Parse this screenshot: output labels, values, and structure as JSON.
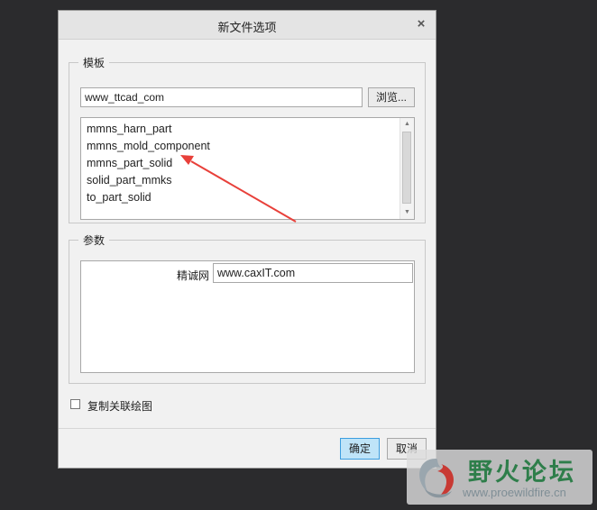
{
  "dialog": {
    "title": "新文件选项",
    "close_glyph": "×"
  },
  "template_group": {
    "label": "模板",
    "path_value": "www_ttcad_com",
    "browse_label": "浏览...",
    "items": [
      "mmns_harn_part",
      "mmns_mold_component",
      "mmns_part_solid",
      "solid_part_mmks",
      "to_part_solid"
    ]
  },
  "params_group": {
    "label": "参数",
    "param_name": "精诚网",
    "param_value": "www.caxIT.com"
  },
  "copy_drawing": {
    "label": "复制关联绘图",
    "checked": false
  },
  "footer": {
    "ok_label": "确定",
    "cancel_label": "取消"
  },
  "annotation": {
    "arrow_color": "#e8403a"
  },
  "watermark": {
    "brand": "野火论坛",
    "url": "www.proewildfire.cn"
  },
  "colors": {
    "background": "#2b2b2d",
    "dialog": "#f1f1f1",
    "ok_button": "#bfe4f8",
    "ok_border": "#3c9ee0",
    "brand_green": "#2e7e4a"
  }
}
